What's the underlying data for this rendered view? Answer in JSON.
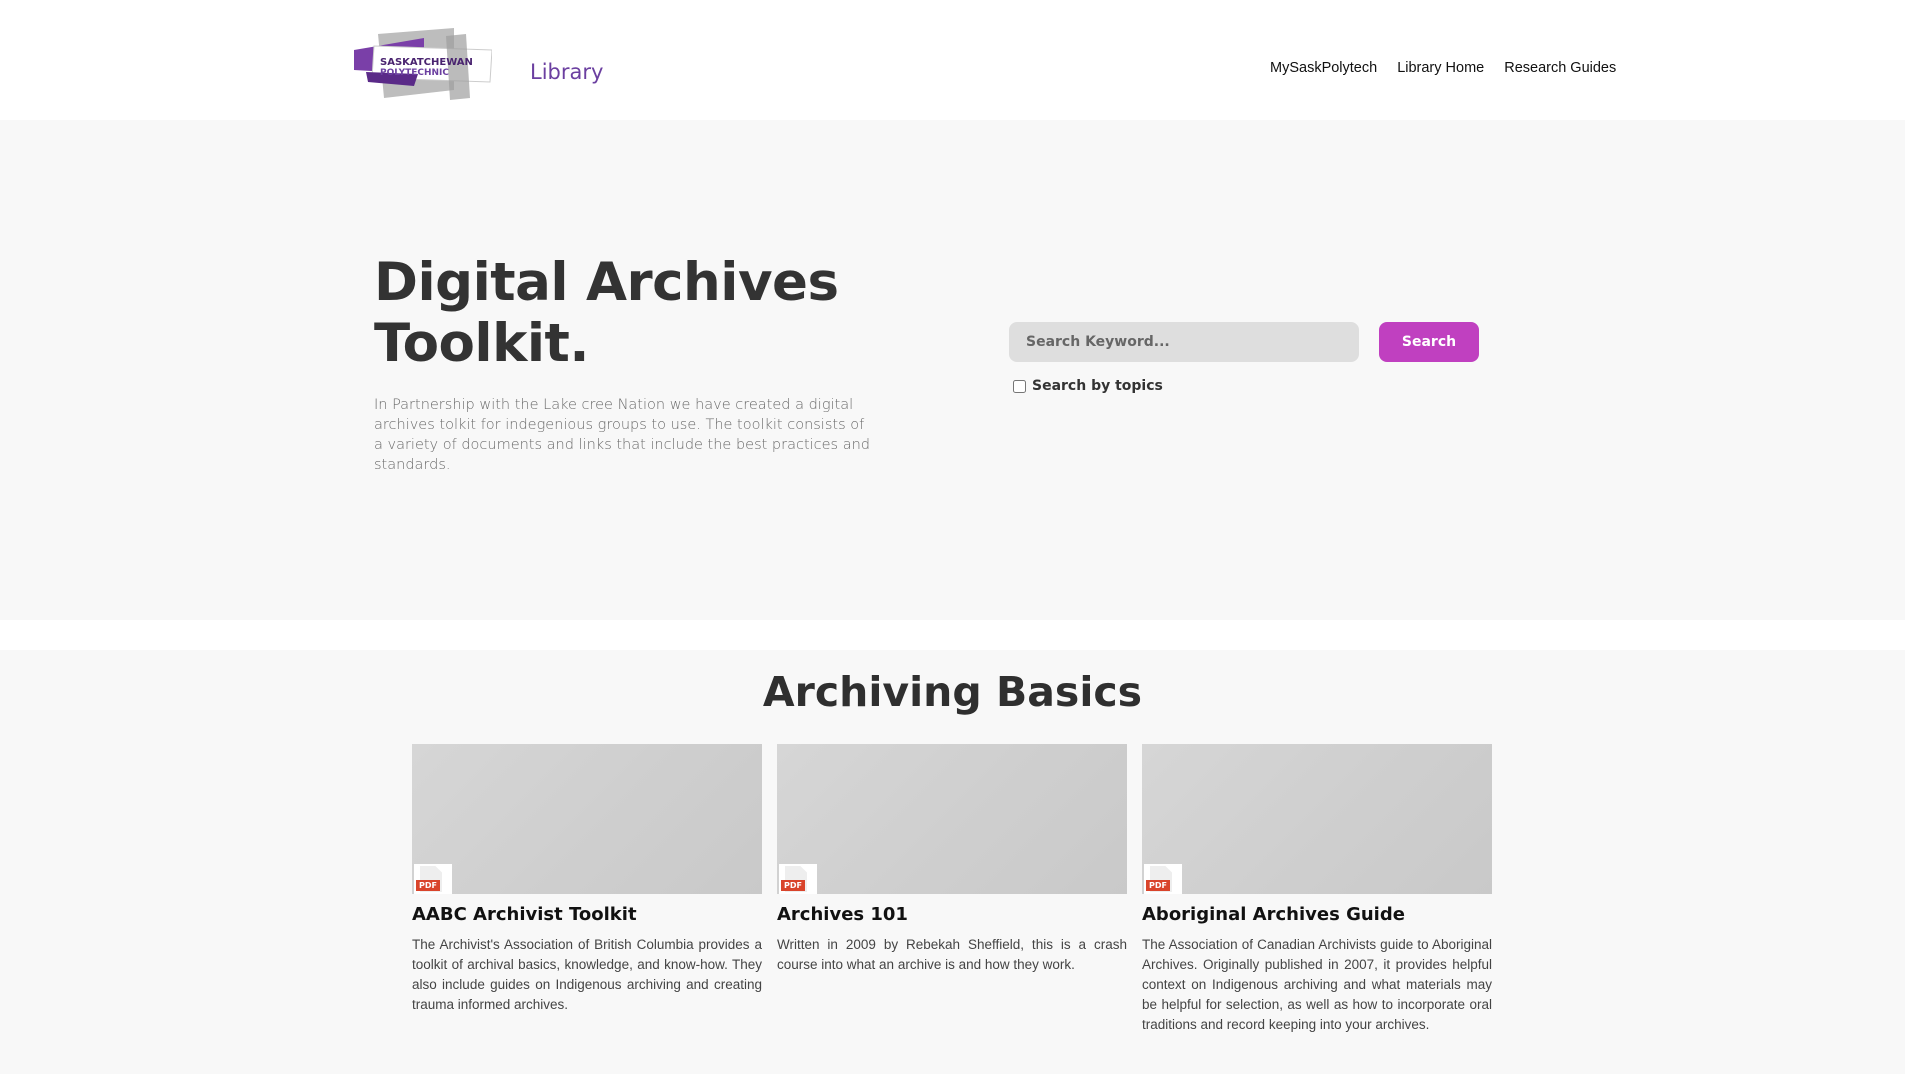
{
  "header": {
    "logo_line1": "SASKATCHEWAN",
    "logo_line2": "POLYTECHNIC",
    "library_label": "Library",
    "nav": [
      "MySaskPolytech",
      "Library Home",
      "Research Guides"
    ]
  },
  "hero": {
    "title_line1": "Digital Archives",
    "title_line2": "Toolkit.",
    "description": "In Partnership with the Lake cree Nation we have created a digital archives tolkit for indegenious groups to use. The toolkit consists of a variety of documents and links that include the best practices and standards.",
    "search_placeholder": "Search Keyword...",
    "search_button": "Search",
    "topics_label": "Search by topics"
  },
  "section": {
    "title": "Archiving Basics",
    "cards": [
      {
        "file_type": "PDF",
        "title": "AABC Archivist Toolkit",
        "description": "The Archivist's Association of British Columbia provides a toolkit of archival basics, knowledge, and know-how. They also include guides on Indigenous archiving and creating trauma informed archives."
      },
      {
        "file_type": "PDF",
        "title": "Archives 101",
        "description": "Written in 2009 by Rebekah Sheffield, this is a crash course into what an archive is and how they work."
      },
      {
        "file_type": "PDF",
        "title": "Aboriginal Archives Guide",
        "description": "The Association of Canadian Archivists guide to Aboriginal Archives. Originally published in 2007, it provides helpful context on Indigenous archiving and what materials may be helpful for selection, as well as how to incorporate oral traditions and record keeping into your archives."
      }
    ]
  },
  "colors": {
    "brand_purple": "#6b3fa0",
    "search_button": "#c040c0",
    "pdf_red": "#d9442b"
  }
}
